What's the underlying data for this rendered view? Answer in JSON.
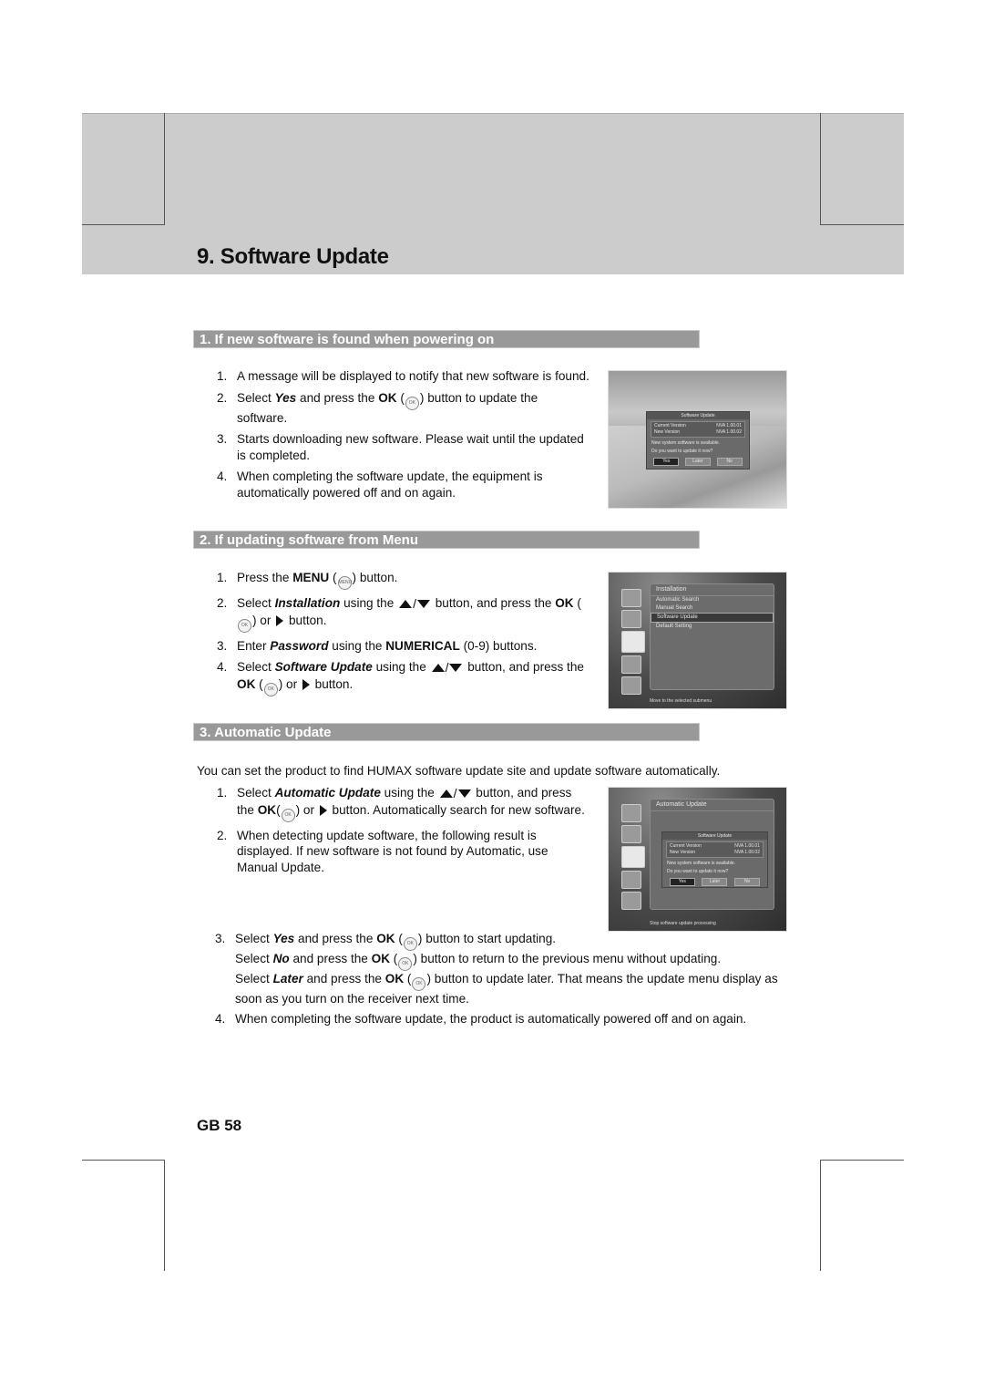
{
  "header": {
    "title": "9. Software Update"
  },
  "sections": [
    {
      "title": "1. If new software is found when powering on",
      "steps": [
        {
          "num": "1.",
          "text": "A message will be displayed to notify that new software is found."
        },
        {
          "num": "2.",
          "pre": "Select ",
          "em": "Yes",
          "mid": " and press the ",
          "strong": "OK",
          "post": " button to update the software."
        },
        {
          "num": "3.",
          "text": "Starts downloading new software. Please wait until the updated is completed."
        },
        {
          "num": "4.",
          "text": "When completing the software update, the equipment is automatically powered off and on again."
        }
      ],
      "screenshot": {
        "dialog_title": "Software Update",
        "current_version_label": "Current Version",
        "current_version_value": "NVA 1.00.01",
        "new_version_label": "New Version",
        "new_version_value": "NVA 1.00.02",
        "message_1": "New system software is available.",
        "message_2": "Do you want to update it now?",
        "buttons": [
          "Yes",
          "Later",
          "No"
        ]
      }
    },
    {
      "title": "2. If updating software from Menu",
      "steps": [
        {
          "num": "1.",
          "pre": "Press the ",
          "strong": "MENU",
          "post": " button."
        },
        {
          "num": "2.",
          "pre": "Select ",
          "em": "Installation",
          "mid": " using the ",
          "mid2": " button, and press the ",
          "strong": "OK",
          "or": " or ",
          "post": " button."
        },
        {
          "num": "3.",
          "pre": "Enter ",
          "em": "Password",
          "mid": " using the ",
          "strong": "NUMERICAL",
          "post": " (0-9) buttons."
        },
        {
          "num": "4.",
          "pre": "Select ",
          "em": "Software Update",
          "mid": " using the ",
          "mid2": " button, and press the ",
          "strong": "OK",
          "or": " or ",
          "post": " button."
        }
      ],
      "screenshot": {
        "menu_title": "Installation",
        "menu_items": [
          "Automatic Search",
          "Manual Search",
          "Software Update",
          "Default Setting"
        ],
        "selected_item": "Software Update",
        "footer": "Move to the selected submenu"
      }
    },
    {
      "title": "3. Automatic Update",
      "intro": "You can set the product to find HUMAX software update site and update software automatically.",
      "steps": [
        {
          "num": "1.",
          "pre": "Select ",
          "em": "Automatic Update",
          "mid": " using the ",
          "mid2": " button, and press the ",
          "strong": "OK",
          "or": " or ",
          "post": " button. Automatically search for new software."
        },
        {
          "num": "2.",
          "text": "When detecting update software, the following result is displayed. If new software is not found by Automatic, use Manual Update."
        },
        {
          "num": "3.",
          "lines": [
            {
              "pre": "Select ",
              "em": "Yes",
              "mid": " and press the ",
              "strong": "OK",
              "post": " button to start updating."
            },
            {
              "pre": "Select ",
              "em": "No",
              "mid": " and press the ",
              "strong": "OK",
              "post": " button to return to the previous menu without updating."
            },
            {
              "pre": "Select ",
              "em": "Later",
              "mid": " and press the ",
              "strong": "OK",
              "post": " button to update later. That means the update menu display as soon as you turn on the receiver next time."
            }
          ]
        },
        {
          "num": "4.",
          "text": "When completing the software update, the product is automatically powered off and on again."
        }
      ],
      "screenshot": {
        "menu_title": "Automatic Update",
        "dialog_title": "Software Update",
        "current_version_label": "Current Version",
        "current_version_value": "NVA 1.00.01",
        "new_version_label": "New Version",
        "new_version_value": "NVA 1.00.02",
        "message_1": "New system software is available.",
        "message_2": "Do you want to update it now?",
        "buttons": [
          "Yes",
          "Later",
          "No"
        ],
        "footer": "Stop software update processing"
      }
    }
  ],
  "icons": {
    "ok": "OK",
    "menu": "MENU"
  },
  "footer": {
    "page_number": "GB 58"
  }
}
